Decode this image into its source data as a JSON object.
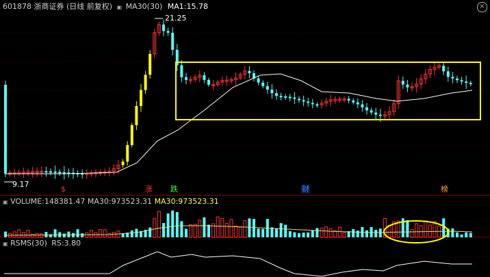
{
  "header": {
    "code": "601878",
    "name": "浙商证券",
    "period": "(日线 前复权)",
    "ma_label": "MA30(30)",
    "ma1_label": "MA1:",
    "ma1_value": "15.78"
  },
  "price_panel": {
    "high_label": "21.25",
    "low_label": "9.17",
    "markers": [
      {
        "text": "$",
        "color": "#ff3232"
      },
      {
        "text": "涨",
        "color": "#ff3232"
      },
      {
        "text": "跌",
        "color": "#33ff33"
      },
      {
        "text": "财",
        "color": "#4080ff"
      },
      {
        "text": "榜",
        "color": "#ffa040"
      }
    ]
  },
  "volume_panel": {
    "label": "VOLUME:",
    "value": "148381.47",
    "ma_label": "MA30:",
    "ma_value": "973523.31",
    "ma_label2": "MA30:",
    "ma_value2": "973523.31"
  },
  "rsms_panel": {
    "label": "RSMS(30)",
    "rs_label": "RS:",
    "rs_value": "3.80"
  },
  "colors": {
    "up": "#ff3232",
    "down": "#54ffff",
    "limit": "#ffff00",
    "ma": "#ffffff",
    "box": "#ffff00"
  },
  "icons": {
    "close": "close-icon",
    "collapse": "collapse-icon"
  }
}
